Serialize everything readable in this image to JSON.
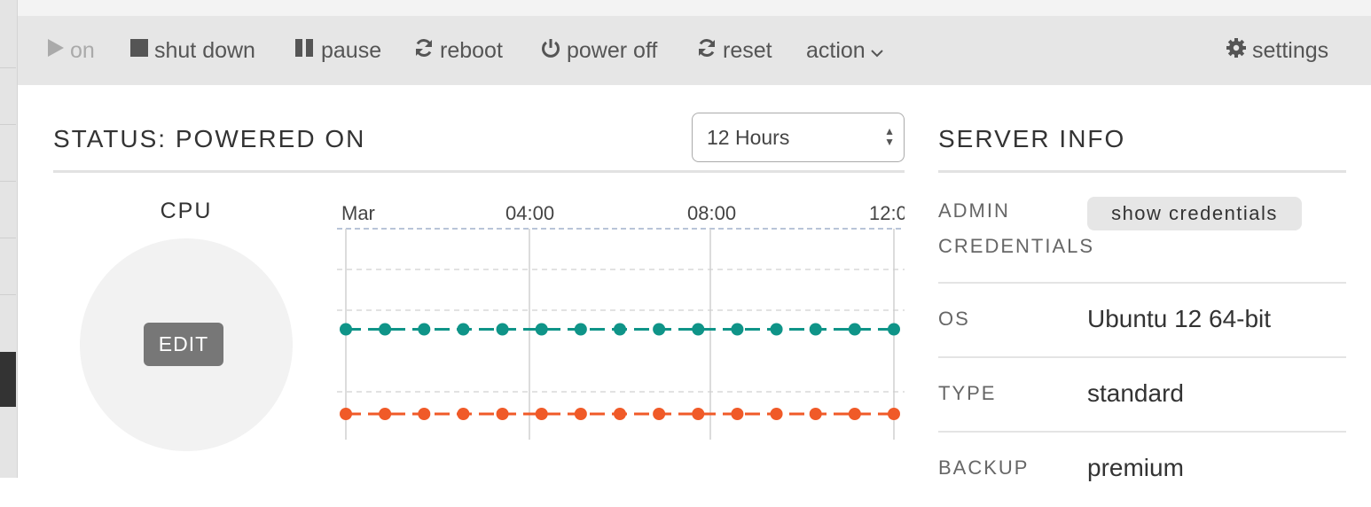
{
  "toolbar": {
    "on_label": "on",
    "shutdown_label": "shut down",
    "pause_label": "pause",
    "reboot_label": "reboot",
    "poweroff_label": "power off",
    "reset_label": "reset",
    "action_label": "action",
    "settings_label": "settings"
  },
  "status": {
    "title": "STATUS: POWERED ON",
    "range_selected": "12 Hours"
  },
  "cpu": {
    "label": "CPU",
    "edit_label": "EDIT"
  },
  "chart_data": {
    "type": "line",
    "x_tick_labels": [
      "Mar",
      "04:00",
      "08:00",
      "12:0"
    ],
    "series": [
      {
        "color": "#0f9488",
        "values": [
          50,
          50,
          50,
          50,
          50,
          50,
          50,
          50,
          50,
          50,
          50,
          50,
          50,
          50,
          50
        ]
      },
      {
        "color": "#f05a28",
        "values": [
          0,
          0,
          0,
          0,
          0,
          0,
          0,
          0,
          0,
          0,
          0,
          0,
          0,
          0,
          0
        ]
      }
    ],
    "grid": true
  },
  "server_info": {
    "title": "SERVER INFO",
    "admin_label_1": "ADMIN",
    "admin_label_2": "CREDENTIALS",
    "show_credentials_label": "show credentials",
    "os_label": "OS",
    "os_value": "Ubuntu 12 64-bit",
    "type_label": "TYPE",
    "type_value": "standard",
    "backup_label": "BACKUP",
    "backup_value": "premium"
  }
}
